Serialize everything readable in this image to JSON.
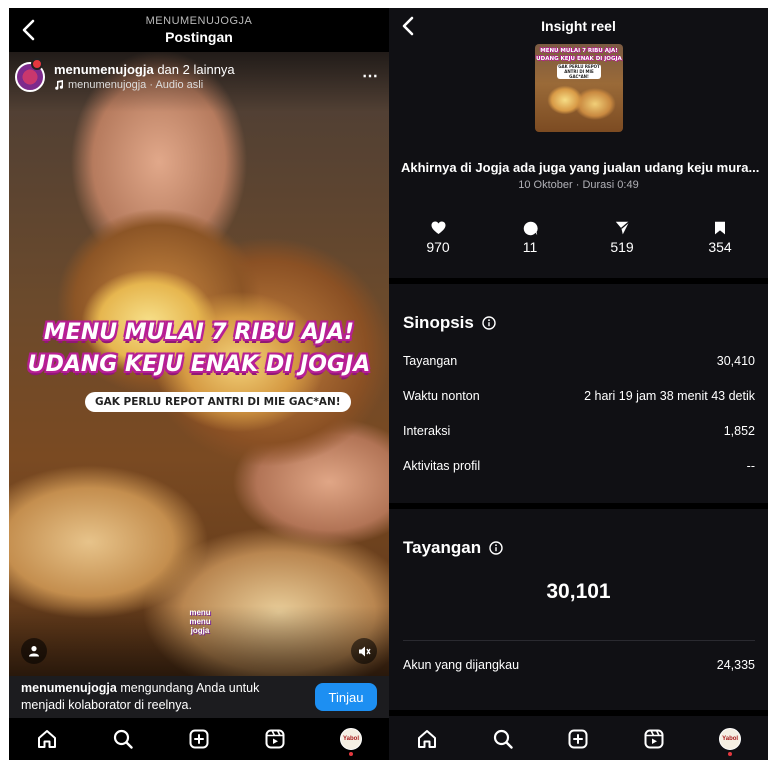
{
  "left": {
    "header": {
      "subtitle": "MENUMENUJOGJA",
      "title": "Postingan"
    },
    "post": {
      "account": "menumenujogja",
      "account_suffix": "dan 2 lainnya",
      "audio": "menumenujogja · Audio asli",
      "caption_line1": "MENU MULAI 7 RIBU AJA!",
      "caption_line2": "UDANG KEJU ENAK DI JOGJA",
      "caption_sub": "GAK PERLU REPOT ANTRI DI MIE GAC*AN!",
      "watermark": "menu menu jogja"
    },
    "collab": {
      "account": "menumenujogja",
      "message": "mengundang Anda untuk menjadi kolaborator di reelnya.",
      "button": "Tinjau"
    },
    "nav_avatar_text": "Yabol"
  },
  "right": {
    "header": {
      "title": "Insight reel"
    },
    "thumb_caption": [
      "MENU MULAI 7 RIBU AJA!",
      "UDANG KEJU ENAK DI JOGJA",
      "GAK PERLU REPOT ANTRI DI MIE GAC*AN!"
    ],
    "reel_title": "Akhirnya di Jogja ada juga yang jualan udang keju mura...",
    "reel_meta": "10 Oktober · Durasi 0:49",
    "stats": {
      "likes": "970",
      "comments": "11",
      "shares": "519",
      "saves": "354"
    },
    "sinopsis": {
      "title": "Sinopsis",
      "rows": [
        {
          "label": "Tayangan",
          "value": "30,410"
        },
        {
          "label": "Waktu nonton",
          "value": "2 hari 19 jam 38 menit 43 detik"
        },
        {
          "label": "Interaksi",
          "value": "1,852"
        },
        {
          "label": "Aktivitas profil",
          "value": "--"
        }
      ]
    },
    "tayangan": {
      "title": "Tayangan",
      "total": "30,101",
      "reached_label": "Akun yang dijangkau",
      "reached_value": "24,335"
    },
    "nav_avatar_text": "Yabol"
  },
  "colors": {
    "accent": "#1d8ff2",
    "caption_magenta": "#b41f93",
    "notification_red": "#e4383f"
  }
}
